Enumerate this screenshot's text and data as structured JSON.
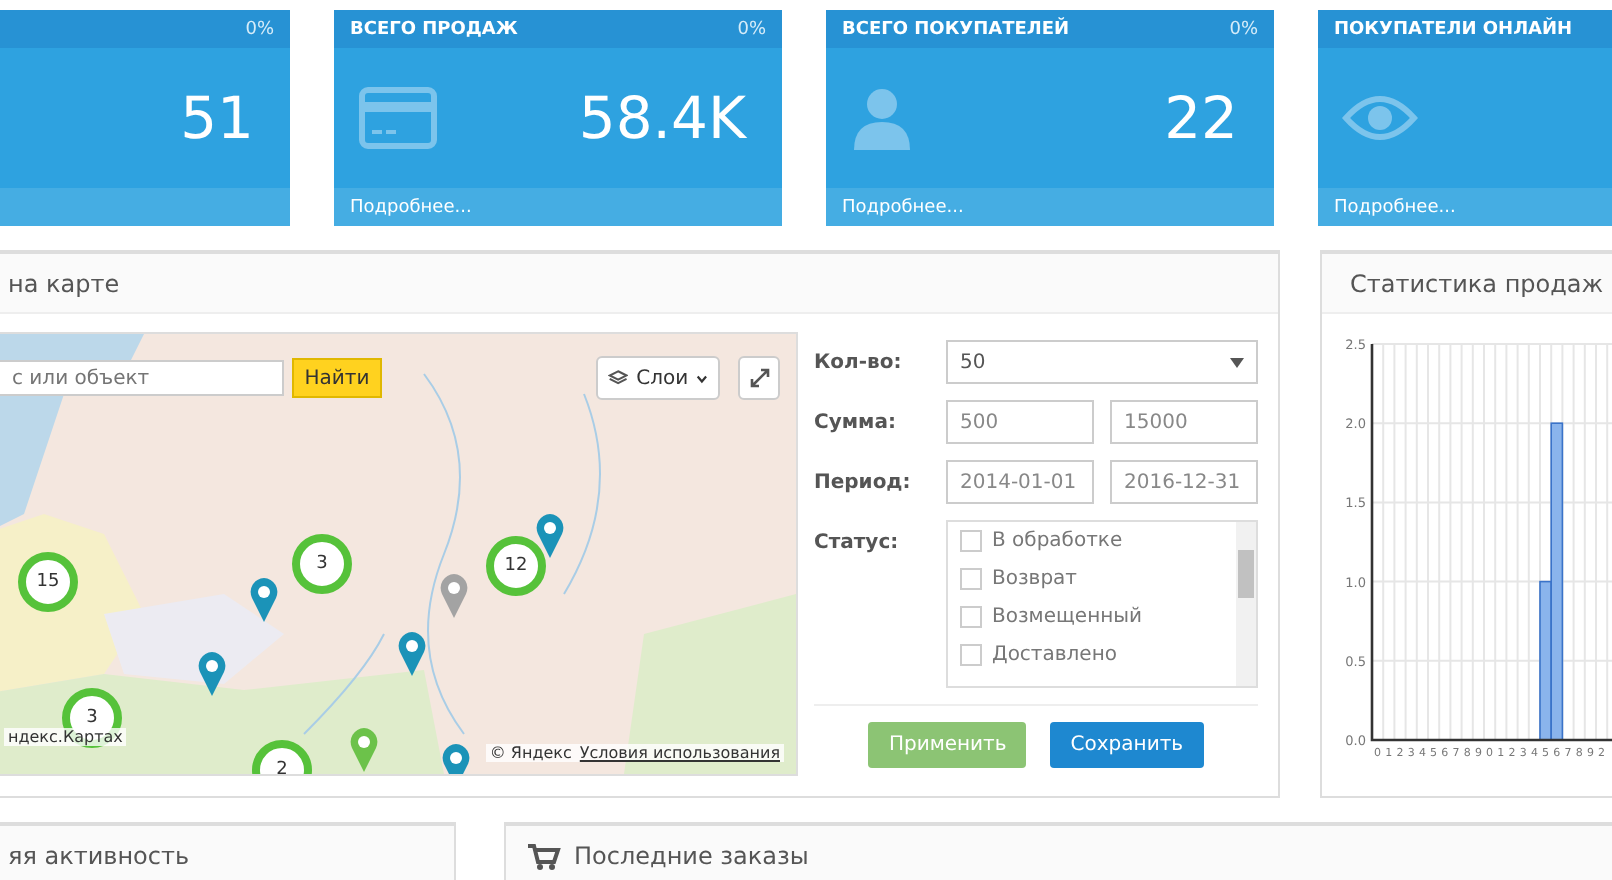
{
  "stat_tiles": [
    {
      "kind": "none",
      "percent": "0%",
      "value": "51"
    },
    {
      "kind": "card",
      "title": "ВСЕГО ПРОДАЖ",
      "percent": "0%",
      "value": "58.4K",
      "more_link": "Подробнее..."
    },
    {
      "kind": "user",
      "title": "ВСЕГО ПОКУПАТЕЛЕЙ",
      "percent": "0%",
      "value": "22",
      "more_link": "Подробнее..."
    },
    {
      "kind": "eye",
      "title": "ПОКУПАТЕЛИ ОНЛАЙН",
      "more_link": "Подробнее..."
    }
  ],
  "map_panel": {
    "title": "на карте",
    "map": {
      "search": {
        "placeholder": "с или объект"
      },
      "find_button": "Найти",
      "layers_button": "Слои",
      "clusters": [
        {
          "count": "15"
        },
        {
          "count": "3"
        },
        {
          "count": "12"
        },
        {
          "count": "3"
        },
        {
          "count": "2"
        }
      ],
      "pins": [
        {
          "color": "#1b93b8"
        },
        {
          "color": "#1b93b8"
        },
        {
          "color": "#1b93b8"
        },
        {
          "color": "#1b93b8"
        },
        {
          "color": "#a3a3a3"
        },
        {
          "color": "#6cc24a"
        },
        {
          "color": "#1b93b8"
        }
      ],
      "attribution": "ндекс.Картах",
      "copyright": "© Яндекс",
      "terms_link": "Условия использования"
    },
    "filter": {
      "count": {
        "label": "Кол-во:",
        "value": "50"
      },
      "sum": {
        "label": "Сумма:",
        "from": "500",
        "to": "15000"
      },
      "period": {
        "label": "Период:",
        "from": "2014-01-01",
        "to": "2016-12-31"
      },
      "status": {
        "label": "Статус:",
        "options": [
          {
            "label": "В обработке",
            "checked": false
          },
          {
            "label": "Возврат",
            "checked": false
          },
          {
            "label": "Возмещенный",
            "checked": false
          },
          {
            "label": "Доставлено",
            "checked": false
          }
        ]
      },
      "buttons": [
        {
          "kind": "apply",
          "label": "Применить"
        },
        {
          "kind": "save",
          "label": "Сохранить"
        }
      ]
    }
  },
  "sales_panel": {
    "title": "Статистика продаж",
    "chart_data": {
      "type": "bar",
      "grid": true,
      "categories": [
        "0",
        "1",
        "2",
        "3",
        "4",
        "5",
        "6",
        "7",
        "8",
        "9",
        "0",
        "1",
        "2",
        "3",
        "4",
        "5",
        "6",
        "7",
        "8",
        "9",
        "2"
      ],
      "series": [
        {
          "color": "#8ab4ec",
          "values": [
            0,
            0,
            0,
            0,
            0,
            0,
            0,
            0,
            0,
            0,
            0,
            0,
            0,
            0,
            0,
            1,
            2,
            0,
            0,
            0,
            0
          ]
        }
      ],
      "ylim": [
        0,
        2.5
      ],
      "yticks": [
        {
          "value": 0,
          "label": "0.0"
        },
        {
          "value": 0.5,
          "label": "0.5"
        },
        {
          "value": 1,
          "label": "1.0"
        },
        {
          "value": 1.5,
          "label": "1.5"
        },
        {
          "value": 2,
          "label": "2.0"
        },
        {
          "value": 2.5,
          "label": "2.5"
        }
      ]
    }
  },
  "bottom_panels": [
    {
      "kind": "plain",
      "title": "яя активность"
    },
    {
      "kind": "cart",
      "title": "Последние заказы"
    }
  ]
}
